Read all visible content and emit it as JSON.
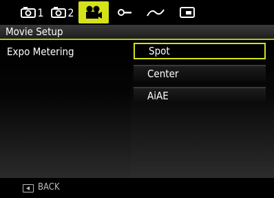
{
  "tabs": [
    {
      "icon": "camera-icon",
      "label": "1"
    },
    {
      "icon": "camera-icon",
      "label": "2"
    },
    {
      "icon": "movie-camera-icon",
      "label": ""
    },
    {
      "icon": "wrench-icon",
      "label": ""
    },
    {
      "icon": "transition-icon",
      "label": ""
    },
    {
      "icon": "playback-icon",
      "label": ""
    }
  ],
  "active_tab": "movie-camera-icon",
  "header": {
    "title": "Movie Setup"
  },
  "setting": {
    "name": "Expo Metering"
  },
  "options": [
    "Spot",
    "Center",
    "AiAE"
  ],
  "selected_option": "Spot",
  "footer": {
    "back_label": "BACK",
    "back_icon": "back-arrow-icon"
  },
  "colors": {
    "accent": "#d4e21a",
    "background": "#000000",
    "text": "#ffffff"
  }
}
